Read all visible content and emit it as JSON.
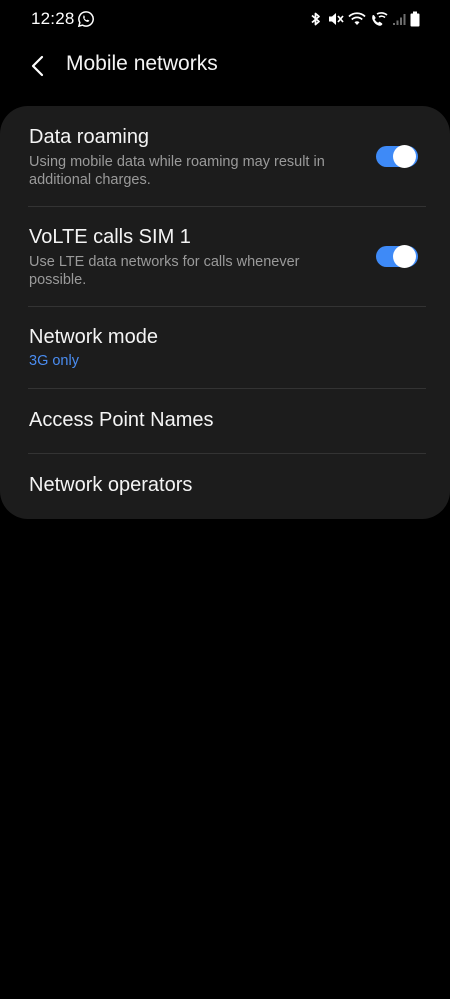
{
  "status_bar": {
    "time": "12:28",
    "icons": [
      "whatsapp-icon",
      "bluetooth-icon",
      "mute-icon",
      "wifi-icon",
      "wifi-call-icon",
      "signal-icon",
      "battery-icon"
    ]
  },
  "header": {
    "title": "Mobile networks",
    "back_icon": "chevron-left-icon"
  },
  "settings": {
    "data_roaming": {
      "title": "Data roaming",
      "description": "Using mobile data while roaming may result in additional charges.",
      "enabled": true
    },
    "volte": {
      "title": "VoLTE calls SIM 1",
      "description": "Use LTE data networks for calls whenever possible.",
      "enabled": true
    },
    "network_mode": {
      "title": "Network mode",
      "value": "3G only"
    },
    "apn": {
      "title": "Access Point Names"
    },
    "operators": {
      "title": "Network operators"
    }
  },
  "colors": {
    "accent": "#3e8af7",
    "link": "#4a8cf0",
    "card": "#1c1c1c",
    "background": "#000000"
  }
}
